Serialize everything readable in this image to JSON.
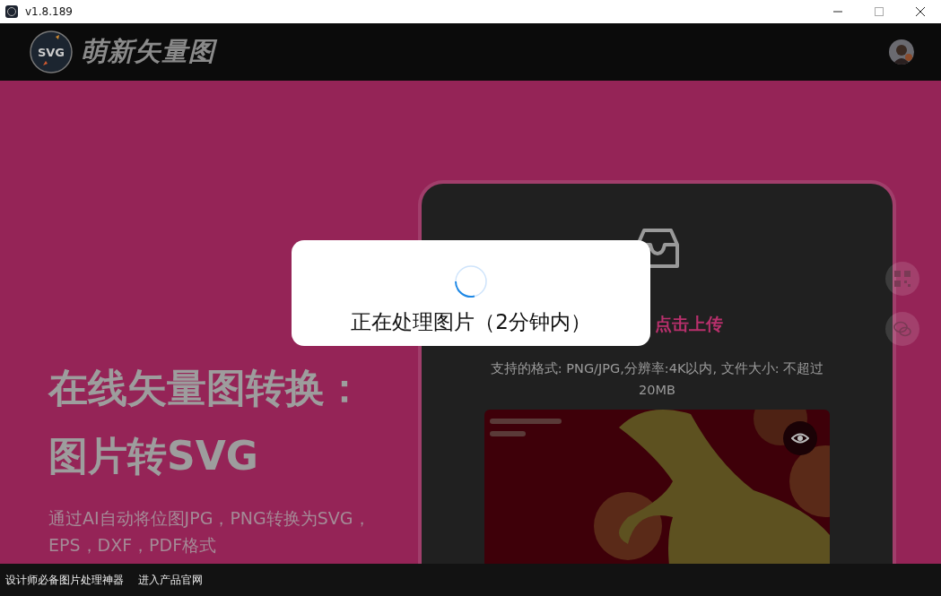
{
  "window": {
    "title": "v1.8.189"
  },
  "header": {
    "logo_text": "SVG",
    "brand": "萌新矢量图"
  },
  "hero": {
    "title_lines": [
      "在线矢量图转换：",
      "图片转SVG"
    ],
    "subtitle": "通过AI自动将位图JPG，PNG转换为SVG，EPS，DXF，PDF格式"
  },
  "upload": {
    "action": "点击上传",
    "hint": "支持的格式: PNG/JPG,分辨率:4K以内, 文件大小: 不超过20MB"
  },
  "modal": {
    "message": "正在处理图片（2分钟内）"
  },
  "footer": {
    "links": [
      "设计师必备图片处理神器",
      "进入产品官网"
    ]
  }
}
